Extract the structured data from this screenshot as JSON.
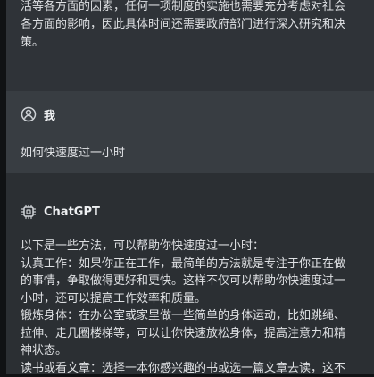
{
  "previous_answer": {
    "line1": "活等各方面的因素，任何一项制度的实施也需要充分考虑对社会",
    "line2": "各方面的影响，因此具体时间还需要政府部门进行深入研究和决",
    "line3": "策。"
  },
  "user_message": {
    "author": "我",
    "text": "如何快速度过一小时"
  },
  "assistant_message": {
    "author": "ChatGPT",
    "lines": [
      "以下是一些方法，可以帮助你快速度过一小时：",
      "认真工作：如果你正在工作，最简单的方法就是专注于你正在做",
      "的事情，争取做得更好和更快。这样不仅可以帮助你快速度过一",
      "小时，还可以提高工作效率和质量。",
      "锻炼身体：在办公室或家里做一些简单的身体运动，比如跳绳、",
      "拉伸、走几圈楼梯等，可以让你快速放松身体，提高注意力和精",
      "神状态。",
      "读书或看文章：选择一本你感兴趣的书或选一篇文章去读，这不"
    ]
  },
  "icons": {
    "user": "user-circle-icon",
    "assistant": "chip-icon"
  }
}
